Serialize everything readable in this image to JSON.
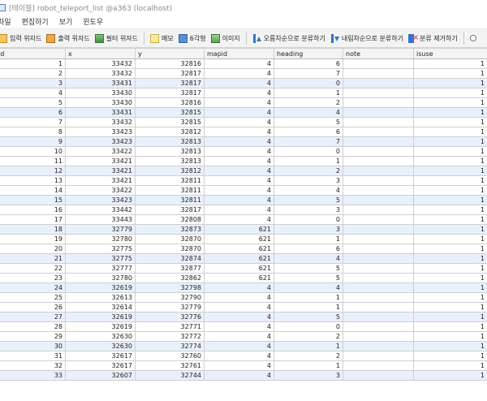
{
  "window": {
    "title": "[테이블] robot_teleport_list @a363 (localhost)"
  },
  "menu": [
    {
      "key": "file",
      "label": "파일"
    },
    {
      "key": "edit",
      "label": "편집하기"
    },
    {
      "key": "view",
      "label": "보기"
    },
    {
      "key": "window",
      "label": "윈도우"
    }
  ],
  "toolbar": [
    {
      "key": "input-wizard",
      "icon": "input-wizard-icon",
      "label": "입력 위자드"
    },
    {
      "key": "output-wizard",
      "icon": "output-wizard-icon",
      "label": "출력 위자드"
    },
    {
      "key": "filter-wizard",
      "icon": "filter-wizard-icon",
      "label": "필터 위자드"
    },
    {
      "key": "memo",
      "icon": "memo-icon",
      "label": "메모"
    },
    {
      "key": "hex",
      "icon": "hex-icon",
      "label": "6각형"
    },
    {
      "key": "image",
      "icon": "image-icon",
      "label": "이미지"
    },
    {
      "key": "sort-asc",
      "icon": "sort-ascending-icon",
      "label": "오름차순으로 분류하기"
    },
    {
      "key": "sort-desc",
      "icon": "sort-descending-icon",
      "label": "내림차순으로 분류하기"
    },
    {
      "key": "remove-sort",
      "icon": "remove-sort-icon",
      "label": "분류 제거하기"
    }
  ],
  "grid": {
    "columns": [
      "id",
      "x",
      "y",
      "mapid",
      "heading",
      "note",
      "isuse"
    ],
    "rows": [
      [
        "1",
        "33432",
        "32816",
        "4",
        "6",
        "",
        "1"
      ],
      [
        "2",
        "33432",
        "32817",
        "4",
        "7",
        "",
        "1"
      ],
      [
        "3",
        "33431",
        "32817",
        "4",
        "0",
        "",
        "1"
      ],
      [
        "4",
        "33430",
        "32817",
        "4",
        "1",
        "",
        "1"
      ],
      [
        "5",
        "33430",
        "32816",
        "4",
        "2",
        "",
        "1"
      ],
      [
        "6",
        "33431",
        "32815",
        "4",
        "4",
        "",
        "1"
      ],
      [
        "7",
        "33432",
        "32815",
        "4",
        "5",
        "",
        "1"
      ],
      [
        "8",
        "33423",
        "32812",
        "4",
        "6",
        "",
        "1"
      ],
      [
        "9",
        "33423",
        "32813",
        "4",
        "7",
        "",
        "1"
      ],
      [
        "10",
        "33422",
        "32813",
        "4",
        "0",
        "",
        "1"
      ],
      [
        "11",
        "33421",
        "32813",
        "4",
        "1",
        "",
        "1"
      ],
      [
        "12",
        "33421",
        "32812",
        "4",
        "2",
        "",
        "1"
      ],
      [
        "13",
        "33421",
        "32811",
        "4",
        "3",
        "",
        "1"
      ],
      [
        "14",
        "33422",
        "32811",
        "4",
        "4",
        "",
        "1"
      ],
      [
        "15",
        "33423",
        "32811",
        "4",
        "5",
        "",
        "1"
      ],
      [
        "16",
        "33442",
        "32817",
        "4",
        "3",
        "",
        "1"
      ],
      [
        "17",
        "33443",
        "32808",
        "4",
        "0",
        "",
        "1"
      ],
      [
        "18",
        "32779",
        "32873",
        "621",
        "3",
        "",
        "1"
      ],
      [
        "19",
        "32780",
        "32870",
        "621",
        "1",
        "",
        "1"
      ],
      [
        "20",
        "32775",
        "32870",
        "621",
        "6",
        "",
        "1"
      ],
      [
        "21",
        "32775",
        "32874",
        "621",
        "4",
        "",
        "1"
      ],
      [
        "22",
        "32777",
        "32877",
        "621",
        "5",
        "",
        "1"
      ],
      [
        "23",
        "32780",
        "32862",
        "621",
        "5",
        "",
        "1"
      ],
      [
        "24",
        "32619",
        "32798",
        "4",
        "4",
        "",
        "1"
      ],
      [
        "25",
        "32613",
        "32790",
        "4",
        "1",
        "",
        "1"
      ],
      [
        "26",
        "32614",
        "32779",
        "4",
        "1",
        "",
        "1"
      ],
      [
        "27",
        "32619",
        "32776",
        "4",
        "5",
        "",
        "1"
      ],
      [
        "28",
        "32619",
        "32771",
        "4",
        "0",
        "",
        "1"
      ],
      [
        "29",
        "32630",
        "32772",
        "4",
        "2",
        "",
        "1"
      ],
      [
        "30",
        "32630",
        "32774",
        "4",
        "1",
        "",
        "1"
      ],
      [
        "31",
        "32617",
        "32760",
        "4",
        "2",
        "",
        "1"
      ],
      [
        "32",
        "32617",
        "32761",
        "4",
        "1",
        "",
        "1"
      ],
      [
        "33",
        "32607",
        "32744",
        "4",
        "3",
        "",
        "1"
      ]
    ]
  }
}
